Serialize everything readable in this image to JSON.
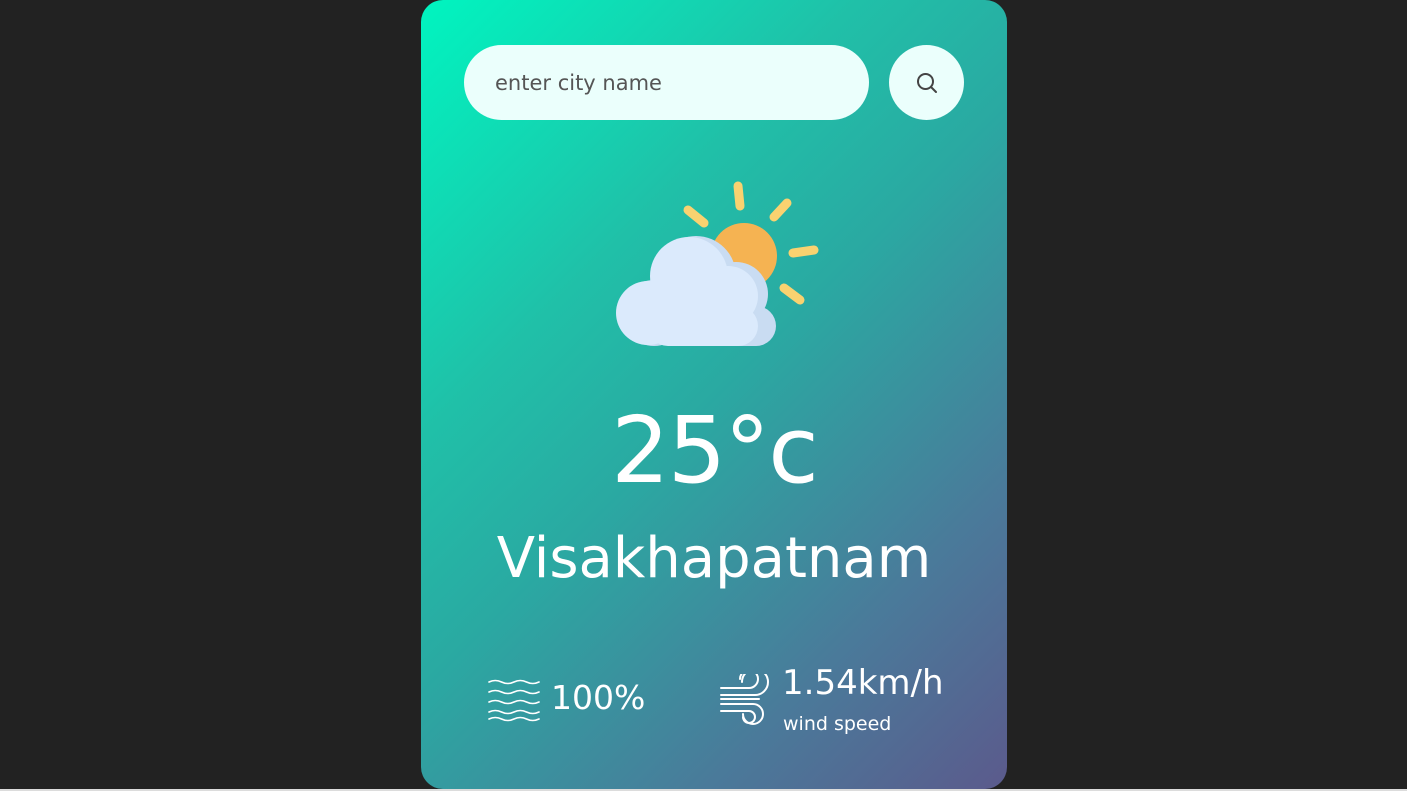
{
  "search": {
    "placeholder": "enter city name",
    "button_icon": "search-icon"
  },
  "weather": {
    "icon": "partly-cloudy-icon",
    "temperature": "25°c",
    "city": "Visakhapatnam"
  },
  "details": {
    "humidity": {
      "icon": "humidity-icon",
      "value": "100%"
    },
    "wind": {
      "icon": "wind-icon",
      "value": "1.54km/h",
      "label": "wind speed"
    }
  },
  "colors": {
    "background": "#222222",
    "gradient_start": "#00f5c0",
    "gradient_end": "#5b5a8c",
    "input_bg": "#ebfffc",
    "text": "#ffffff"
  }
}
